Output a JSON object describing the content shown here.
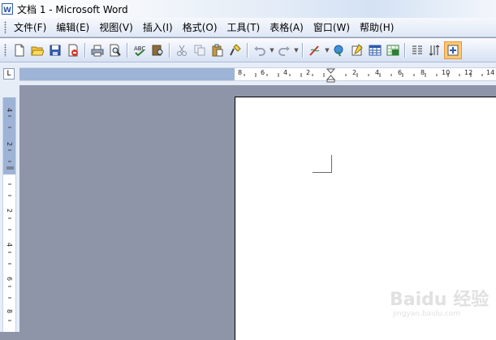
{
  "window": {
    "title": "文档 1 - Microsoft Word"
  },
  "menu": [
    {
      "label": "文件(F)"
    },
    {
      "label": "编辑(E)"
    },
    {
      "label": "视图(V)"
    },
    {
      "label": "插入(I)"
    },
    {
      "label": "格式(O)"
    },
    {
      "label": "工具(T)"
    },
    {
      "label": "表格(A)"
    },
    {
      "label": "窗口(W)"
    },
    {
      "label": "帮助(H)"
    }
  ],
  "toolbar": {
    "buttons": [
      {
        "icon": "new-document-icon"
      },
      {
        "icon": "open-folder-icon"
      },
      {
        "icon": "save-icon"
      },
      {
        "icon": "permission-icon"
      },
      {
        "icon": "print-icon"
      },
      {
        "icon": "print-preview-icon"
      },
      {
        "icon": "spelling-icon"
      },
      {
        "icon": "research-icon"
      },
      {
        "icon": "cut-icon"
      },
      {
        "icon": "copy-icon"
      },
      {
        "icon": "paste-icon"
      },
      {
        "icon": "format-painter-icon"
      },
      {
        "icon": "undo-icon"
      },
      {
        "icon": "redo-icon"
      },
      {
        "icon": "ink-icon"
      },
      {
        "icon": "hyperlink-icon"
      },
      {
        "icon": "tables-borders-icon"
      },
      {
        "icon": "insert-table-icon"
      },
      {
        "icon": "insert-excel-icon"
      },
      {
        "icon": "columns-icon"
      },
      {
        "icon": "drawing-icon"
      },
      {
        "icon": "document-map-icon"
      }
    ]
  },
  "hruler": {
    "labels": [
      "8",
      "6",
      "4",
      "2",
      "2",
      "4",
      "6",
      "8",
      "10",
      "12",
      "14"
    ]
  },
  "vruler": {
    "labels": [
      "4",
      "2",
      "2",
      "4",
      "6",
      "8"
    ]
  },
  "watermark": {
    "main": "Baidu 经验",
    "sub": "jingyan.baidu.com"
  },
  "colors": {
    "workspace": "#8e95a8",
    "ruler_margin": "#9eb4d6",
    "active_button": "#ffc873"
  }
}
